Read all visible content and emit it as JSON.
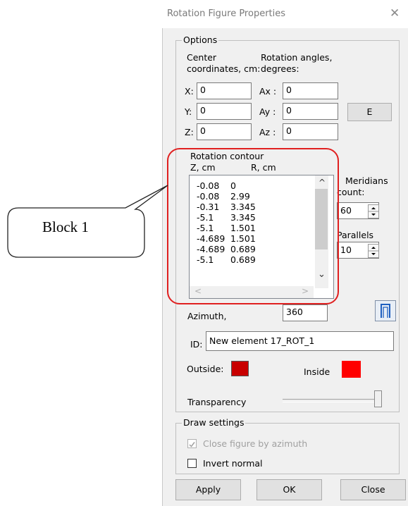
{
  "window": {
    "title": "Rotation Figure Properties",
    "close_glyph": "✕"
  },
  "options": {
    "group_label": "Options",
    "center_label_1": "Center",
    "center_label_2": "coordinates, cm:",
    "angles_label_1": "Rotation angles,",
    "angles_label_2": "degrees:",
    "x_label": "X:",
    "x_value": "0",
    "y_label": "Y:",
    "y_value": "0",
    "z_label": "Z:",
    "z_value": "0",
    "ax_label": "Ax :",
    "ax_value": "0",
    "ay_label": "Ay :",
    "ay_value": "0",
    "az_label": "Az :",
    "az_value": "0",
    "e_button": "E"
  },
  "contour": {
    "title": "Rotation contour",
    "col_z": "Z, cm",
    "col_r": "R, cm",
    "rows": [
      [
        "-0.08",
        "0"
      ],
      [
        "-0.08",
        "2.99"
      ],
      [
        "-0.31",
        "3.345"
      ],
      [
        "-5.1",
        "3.345"
      ],
      [
        "-5.1",
        "1.501"
      ],
      [
        "-4.689",
        "1.501"
      ],
      [
        "-4.689",
        "0.689"
      ],
      [
        "-5.1",
        "0.689"
      ]
    ],
    "scroll_up": "^",
    "scroll_down": "⌄",
    "scroll_left": "<",
    "scroll_right": ">"
  },
  "meridians": {
    "label_1": "Meridians",
    "label_2": "count:",
    "value": "60"
  },
  "parallels": {
    "label": "Parallels",
    "value": "10"
  },
  "azimuth": {
    "label": "Azimuth,",
    "value": "360"
  },
  "id_field": {
    "label": "ID:",
    "value": "New element 17_ROT_1"
  },
  "colors": {
    "outside_label": "Outside:",
    "outside_color": "#c80000",
    "inside_label": "Inside",
    "inside_color": "#ff0000"
  },
  "transparency": {
    "label": "Transparency",
    "level": 1.0
  },
  "draw_settings": {
    "group_label": "Draw settings",
    "close_by_azimuth": "Close figure by azimuth",
    "invert_normal": "Invert normal"
  },
  "buttons": {
    "apply": "Apply",
    "ok": "OK",
    "close": "Close"
  },
  "annotation": {
    "callout": "Block 1"
  }
}
